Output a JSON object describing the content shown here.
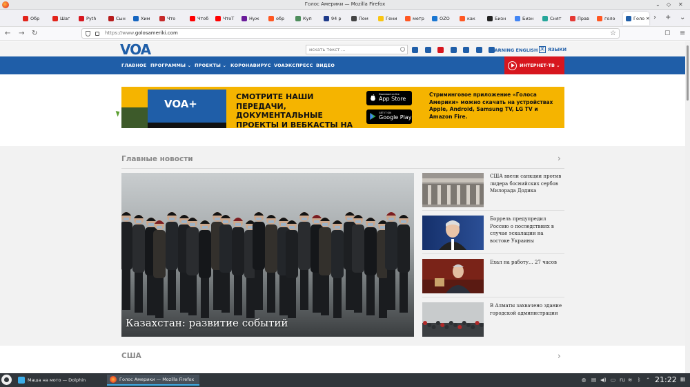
{
  "window": {
    "title": "Голос Америки — Mozilla Firefox",
    "controls": [
      "⌄",
      "◇",
      "✕"
    ]
  },
  "tabs": [
    {
      "label": "Обр",
      "color": "#e2231a"
    },
    {
      "label": "Шаг",
      "color": "#e2231a"
    },
    {
      "label": "Pyth",
      "color": "#d7161e"
    },
    {
      "label": "Сын",
      "color": "#b71c1c"
    },
    {
      "label": "Хим",
      "color": "#1565c0"
    },
    {
      "label": "Что",
      "color": "#c62828"
    },
    {
      "label": "Чтоб",
      "color": "#ff0000"
    },
    {
      "label": "ЧтоТ",
      "color": "#ff0000"
    },
    {
      "label": "Нуж",
      "color": "#6a1b9a"
    },
    {
      "label": "обр",
      "color": "#ff5722"
    },
    {
      "label": "Куп",
      "color": "#4e8d5c"
    },
    {
      "label": "94 р",
      "color": "#1e3a8a"
    },
    {
      "label": "Пом",
      "color": "#444444"
    },
    {
      "label": "Гени",
      "color": "#f9c513"
    },
    {
      "label": "метр",
      "color": "#ff5722"
    },
    {
      "label": "OZO",
      "color": "#1976d2"
    },
    {
      "label": "как",
      "color": "#ff5722"
    },
    {
      "label": "Бизн",
      "color": "#222222"
    },
    {
      "label": "Бизн",
      "color": "#4285f4"
    },
    {
      "label": "Снят",
      "color": "#26a69a"
    },
    {
      "label": "Прав",
      "color": "#e53935"
    },
    {
      "label": "голо",
      "color": "#ff5722"
    },
    {
      "label": "Голо",
      "color": "#1f5ea8",
      "active": true
    }
  ],
  "tab_buttons": {
    "scroll": "›",
    "new_tab": "+",
    "list": "⌄"
  },
  "nav": {
    "back": "←",
    "forward": "→",
    "reload": "↻",
    "url_prefix": "https://www.",
    "url_domain": "golosameriki.com",
    "bookmark": "☆",
    "pocket": "▢",
    "menu": "≡"
  },
  "site": {
    "logo": "VOA",
    "search_placeholder": "искать текст ...",
    "social_icons": [
      {
        "name": "facebook-icon",
        "color": "#1f5ea8"
      },
      {
        "name": "twitter-icon",
        "color": "#1f5ea8"
      },
      {
        "name": "youtube-icon",
        "color": "#d7161e"
      },
      {
        "name": "vk-icon",
        "color": "#1f5ea8"
      },
      {
        "name": "telegram-icon",
        "color": "#1f5ea8"
      },
      {
        "name": "ok-icon",
        "color": "#1f5ea8"
      },
      {
        "name": "instagram-icon",
        "color": "#1f5ea8"
      }
    ],
    "learning_english": "LEARNING ENGLISH",
    "languages": "ЯЗЫКИ",
    "menu": [
      "ГЛАВНОЕ",
      "ПРОГРАММЫ",
      "ПРОЕКТЫ",
      "КОРОНАВИРУС",
      "VOAЭКСПРЕСС",
      "ВИДЕО"
    ],
    "dropdown_marks": [
      "⌄",
      "⌄"
    ],
    "internet_tv": "ИНТЕРНЕТ-ТВ",
    "accent": "#1f5ea8",
    "red": "#d7161e"
  },
  "banner": {
    "tv_logo": "VOA+",
    "headline": "СМОТРИТЕ НАШИ ПЕРЕДАЧИ, ДОКУМЕНТАЛЬНЫЕ ПРОЕКТЫ И ВЕБКАСТЫ НА VOA+",
    "app_store_small": "Download on the",
    "app_store_big": "App Store",
    "google_small": "GET IT ON",
    "google_big": "Google Play",
    "info": "Стриминговое приложение «Голоса Америки» можно скачать на устройствах Apple, Android, Samsung TV, LG TV и Amazon Fire."
  },
  "sections": {
    "main_title": "Главные новости",
    "usa_title": "США",
    "chevron": "›"
  },
  "hero": {
    "caption": "Казахстан: развитие событий"
  },
  "side_news": [
    {
      "text": "США ввели санкции против лидера боснийских сербов Милорада Додика"
    },
    {
      "text": "Боррель предупредил Россию о последствиях в случае эскалации на востоке Украины"
    },
    {
      "text": "Ехал на работу... 27 часов"
    },
    {
      "text": "В Алматы захвачено здание городской администрации"
    }
  ],
  "taskbar": {
    "tasks": [
      {
        "label": "Маша на мото — Dolphin"
      },
      {
        "label": "Голос Америки — Mozilla Firefox"
      }
    ],
    "lang": "ru",
    "clock": "21:22"
  }
}
